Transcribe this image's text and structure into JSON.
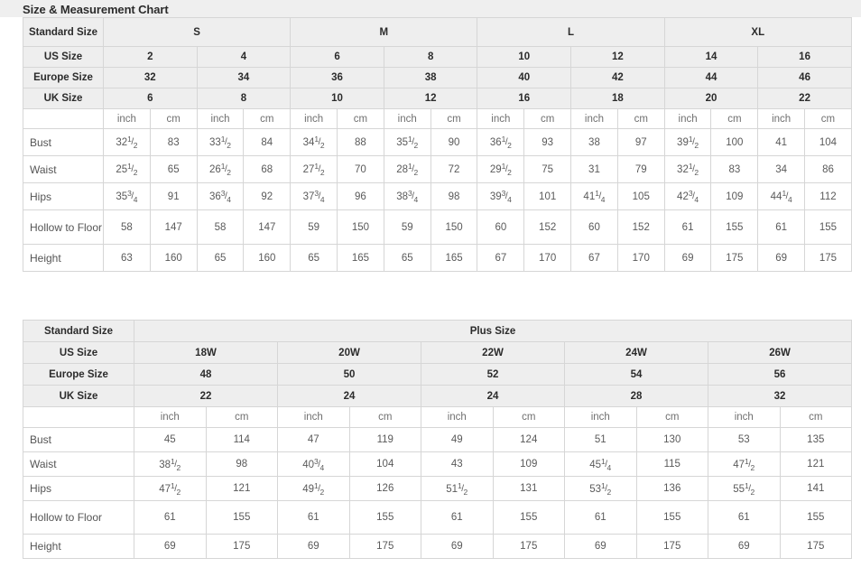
{
  "page": {
    "title": "Size & Measurement Chart"
  },
  "standard_table": {
    "name": "standard-size-chart",
    "corner_label": "Standard Size",
    "group_headers": [
      "S",
      "M",
      "L",
      "XL"
    ],
    "size_rows": [
      {
        "label": "US Size",
        "values": [
          "2",
          "4",
          "6",
          "8",
          "10",
          "12",
          "14",
          "16"
        ]
      },
      {
        "label": "Europe Size",
        "values": [
          "32",
          "34",
          "36",
          "38",
          "40",
          "42",
          "44",
          "46"
        ]
      },
      {
        "label": "UK Size",
        "values": [
          "6",
          "8",
          "10",
          "12",
          "16",
          "18",
          "20",
          "22"
        ]
      }
    ],
    "unit_row": {
      "label": "",
      "units": [
        "inch",
        "cm",
        "inch",
        "cm",
        "inch",
        "cm",
        "inch",
        "cm",
        "inch",
        "cm",
        "inch",
        "cm",
        "inch",
        "cm",
        "inch",
        "cm"
      ]
    },
    "measure_rows": [
      {
        "label": "Bust",
        "cells": [
          {
            "whole": "32",
            "num": "1",
            "den": "2"
          },
          {
            "whole": "83"
          },
          {
            "whole": "33",
            "num": "1",
            "den": "2"
          },
          {
            "whole": "84"
          },
          {
            "whole": "34",
            "num": "1",
            "den": "2"
          },
          {
            "whole": "88"
          },
          {
            "whole": "35",
            "num": "1",
            "den": "2"
          },
          {
            "whole": "90"
          },
          {
            "whole": "36",
            "num": "1",
            "den": "2"
          },
          {
            "whole": "93"
          },
          {
            "whole": "38"
          },
          {
            "whole": "97"
          },
          {
            "whole": "39",
            "num": "1",
            "den": "2"
          },
          {
            "whole": "100"
          },
          {
            "whole": "41"
          },
          {
            "whole": "104"
          }
        ]
      },
      {
        "label": "Waist",
        "cells": [
          {
            "whole": "25",
            "num": "1",
            "den": "2"
          },
          {
            "whole": "65"
          },
          {
            "whole": "26",
            "num": "1",
            "den": "2"
          },
          {
            "whole": "68"
          },
          {
            "whole": "27",
            "num": "1",
            "den": "2"
          },
          {
            "whole": "70"
          },
          {
            "whole": "28",
            "num": "1",
            "den": "2"
          },
          {
            "whole": "72"
          },
          {
            "whole": "29",
            "num": "1",
            "den": "2"
          },
          {
            "whole": "75"
          },
          {
            "whole": "31"
          },
          {
            "whole": "79"
          },
          {
            "whole": "32",
            "num": "1",
            "den": "2"
          },
          {
            "whole": "83"
          },
          {
            "whole": "34"
          },
          {
            "whole": "86"
          }
        ]
      },
      {
        "label": "Hips",
        "cells": [
          {
            "whole": "35",
            "num": "3",
            "den": "4"
          },
          {
            "whole": "91"
          },
          {
            "whole": "36",
            "num": "3",
            "den": "4"
          },
          {
            "whole": "92"
          },
          {
            "whole": "37",
            "num": "3",
            "den": "4"
          },
          {
            "whole": "96"
          },
          {
            "whole": "38",
            "num": "3",
            "den": "4"
          },
          {
            "whole": "98"
          },
          {
            "whole": "39",
            "num": "3",
            "den": "4"
          },
          {
            "whole": "101"
          },
          {
            "whole": "41",
            "num": "1",
            "den": "4"
          },
          {
            "whole": "105"
          },
          {
            "whole": "42",
            "num": "3",
            "den": "4"
          },
          {
            "whole": "109"
          },
          {
            "whole": "44",
            "num": "1",
            "den": "4"
          },
          {
            "whole": "112"
          }
        ]
      },
      {
        "label": "Hollow to Floor",
        "tall": true,
        "cells": [
          {
            "whole": "58"
          },
          {
            "whole": "147"
          },
          {
            "whole": "58"
          },
          {
            "whole": "147"
          },
          {
            "whole": "59"
          },
          {
            "whole": "150"
          },
          {
            "whole": "59"
          },
          {
            "whole": "150"
          },
          {
            "whole": "60"
          },
          {
            "whole": "152"
          },
          {
            "whole": "60"
          },
          {
            "whole": "152"
          },
          {
            "whole": "61"
          },
          {
            "whole": "155"
          },
          {
            "whole": "61"
          },
          {
            "whole": "155"
          }
        ]
      },
      {
        "label": "Height",
        "cells": [
          {
            "whole": "63"
          },
          {
            "whole": "160"
          },
          {
            "whole": "65"
          },
          {
            "whole": "160"
          },
          {
            "whole": "65"
          },
          {
            "whole": "165"
          },
          {
            "whole": "65"
          },
          {
            "whole": "165"
          },
          {
            "whole": "67"
          },
          {
            "whole": "170"
          },
          {
            "whole": "67"
          },
          {
            "whole": "170"
          },
          {
            "whole": "69"
          },
          {
            "whole": "175"
          },
          {
            "whole": "69"
          },
          {
            "whole": "175"
          }
        ]
      }
    ]
  },
  "plus_table": {
    "name": "plus-size-chart",
    "corner_label": "Standard Size",
    "group_header": "Plus Size",
    "size_rows": [
      {
        "label": "US Size",
        "values": [
          "18W",
          "20W",
          "22W",
          "24W",
          "26W"
        ]
      },
      {
        "label": "Europe Size",
        "values": [
          "48",
          "50",
          "52",
          "54",
          "56"
        ]
      },
      {
        "label": "UK Size",
        "values": [
          "22",
          "24",
          "24",
          "28",
          "32"
        ]
      }
    ],
    "unit_row": {
      "label": "",
      "units": [
        "inch",
        "cm",
        "inch",
        "cm",
        "inch",
        "cm",
        "inch",
        "cm",
        "inch",
        "cm"
      ]
    },
    "measure_rows": [
      {
        "label": "Bust",
        "cells": [
          {
            "whole": "45"
          },
          {
            "whole": "114"
          },
          {
            "whole": "47"
          },
          {
            "whole": "119"
          },
          {
            "whole": "49"
          },
          {
            "whole": "124"
          },
          {
            "whole": "51"
          },
          {
            "whole": "130"
          },
          {
            "whole": "53"
          },
          {
            "whole": "135"
          }
        ]
      },
      {
        "label": "Waist",
        "cells": [
          {
            "whole": "38",
            "num": "1",
            "den": "2"
          },
          {
            "whole": "98"
          },
          {
            "whole": "40",
            "num": "3",
            "den": "4"
          },
          {
            "whole": "104"
          },
          {
            "whole": "43"
          },
          {
            "whole": "109"
          },
          {
            "whole": "45",
            "num": "1",
            "den": "4"
          },
          {
            "whole": "115"
          },
          {
            "whole": "47",
            "num": "1",
            "den": "2"
          },
          {
            "whole": "121"
          }
        ]
      },
      {
        "label": "Hips",
        "cells": [
          {
            "whole": "47",
            "num": "1",
            "den": "2"
          },
          {
            "whole": "121"
          },
          {
            "whole": "49",
            "num": "1",
            "den": "2"
          },
          {
            "whole": "126"
          },
          {
            "whole": "51",
            "num": "1",
            "den": "2"
          },
          {
            "whole": "131"
          },
          {
            "whole": "53",
            "num": "1",
            "den": "2"
          },
          {
            "whole": "136"
          },
          {
            "whole": "55",
            "num": "1",
            "den": "2"
          },
          {
            "whole": "141"
          }
        ]
      },
      {
        "label": "Hollow to Floor",
        "tall": true,
        "cells": [
          {
            "whole": "61"
          },
          {
            "whole": "155"
          },
          {
            "whole": "61"
          },
          {
            "whole": "155"
          },
          {
            "whole": "61"
          },
          {
            "whole": "155"
          },
          {
            "whole": "61"
          },
          {
            "whole": "155"
          },
          {
            "whole": "61"
          },
          {
            "whole": "155"
          }
        ]
      },
      {
        "label": "Height",
        "cells": [
          {
            "whole": "69"
          },
          {
            "whole": "175"
          },
          {
            "whole": "69"
          },
          {
            "whole": "175"
          },
          {
            "whole": "69"
          },
          {
            "whole": "175"
          },
          {
            "whole": "69"
          },
          {
            "whole": "175"
          },
          {
            "whole": "69"
          },
          {
            "whole": "175"
          }
        ]
      }
    ]
  },
  "colors": {
    "title_bar_bg": "#efefef",
    "header_cell_bg": "#eeeeee",
    "border": "#d6d6d6",
    "outer_border": "#c9c9c9",
    "text": "#4a4a4a",
    "header_text": "#2b2b2b"
  }
}
